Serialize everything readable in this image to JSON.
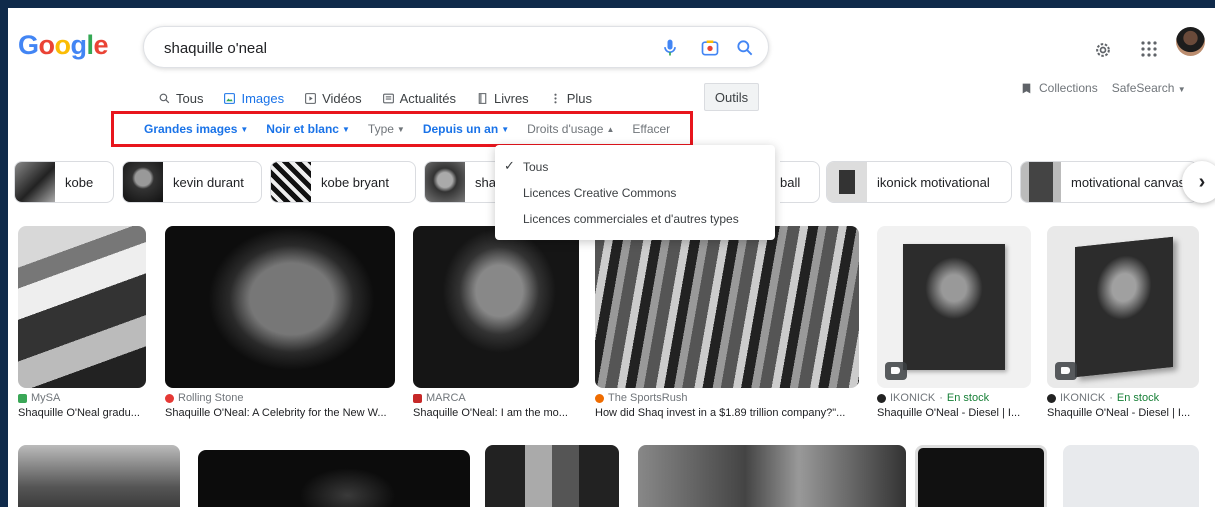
{
  "header": {
    "logo": "Google",
    "search_value": "shaquille o'neal",
    "search_placeholder": "",
    "icons": [
      "mic-icon",
      "lens-icon",
      "search-icon",
      "gear-icon",
      "apps-icon"
    ]
  },
  "tabs": [
    {
      "label": "Tous",
      "icon": "search-icon",
      "active": false
    },
    {
      "label": "Images",
      "icon": "images-icon",
      "active": true
    },
    {
      "label": "Vidéos",
      "icon": "play-icon",
      "active": false
    },
    {
      "label": "Actualités",
      "icon": "news-icon",
      "active": false
    },
    {
      "label": "Livres",
      "icon": "book-icon",
      "active": false
    },
    {
      "label": "Plus",
      "icon": "more-icon",
      "active": false
    }
  ],
  "tools_label": "Outils",
  "collections_label": "Collections",
  "safesearch_label": "SafeSearch",
  "filters": [
    {
      "label": "Grandes images",
      "selected": true
    },
    {
      "label": "Noir et blanc",
      "selected": true
    },
    {
      "label": "Type",
      "selected": false
    },
    {
      "label": "Depuis un an",
      "selected": true
    },
    {
      "label": "Droits d'usage",
      "selected": false
    },
    {
      "label": "Effacer",
      "selected": false
    }
  ],
  "chips": [
    "kobe",
    "kevin durant",
    "kobe bryant",
    "shac",
    "ball",
    "ikonick motivational",
    "motivational canvas"
  ],
  "rights_dropdown": {
    "items": [
      "Tous",
      "Licences Creative Commons",
      "Licences commerciales et d'autres types"
    ],
    "checked": "Tous"
  },
  "results": [
    {
      "source": "MySA",
      "title": "Shaquille O'Neal gradu...",
      "stock": ""
    },
    {
      "source": "Rolling Stone",
      "title": "Shaquille O'Neal: A Celebrity for the New W...",
      "stock": ""
    },
    {
      "source": "MARCA",
      "title": "Shaquille O'Neal: I am the mo...",
      "stock": ""
    },
    {
      "source": "The SportsRush",
      "title": "How did Shaq invest in a $1.89 trillion company?\"...",
      "stock": ""
    },
    {
      "source": "IKONICK",
      "title": "Shaquille O'Neal - Diesel | I...",
      "stock": "En stock"
    },
    {
      "source": "IKONICK",
      "title": "Shaquille O'Neal - Diesel | I...",
      "stock": "En stock"
    }
  ],
  "colors": {
    "accent": "#1a73e8",
    "highlight_border": "#e8151d",
    "frame": "#0f2a4a",
    "in_stock": "#188038"
  }
}
